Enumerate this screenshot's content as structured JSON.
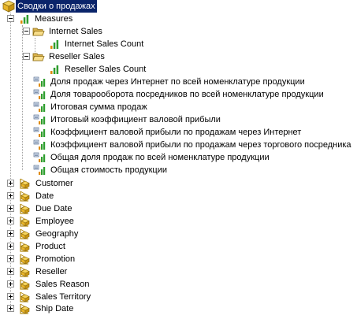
{
  "cube": {
    "label": "Сводки о продажах"
  },
  "measures": {
    "label": "Measures",
    "groups": [
      {
        "label": "Internet Sales",
        "items": [
          "Internet Sales Count"
        ]
      },
      {
        "label": "Reseller Sales",
        "items": [
          "Reseller Sales Count"
        ]
      }
    ],
    "calculated": [
      "Доля продаж через Интернет по всей номенклатуре продукции",
      "Доля товарооборота посредников по всей номенклатуре продукции",
      "Итоговая сумма продаж",
      "Итоговый коэффициент валовой прибыли",
      "Коэффициент валовой прибыли по продажам через Интернет",
      "Коэффициент валовой прибыли по продажам через торгового посредника",
      "Общая доля продаж по всей номенклатуре продукции",
      "Общая стоимость продукции"
    ]
  },
  "dimensions": [
    "Customer",
    "Date",
    "Due Date",
    "Employee",
    "Geography",
    "Product",
    "Promotion",
    "Reseller",
    "Sales Reason",
    "Sales Territory",
    "Ship Date"
  ],
  "colors": {
    "selection": "#0a246a",
    "folder": "#f2d17a",
    "cube": "#e8b428"
  }
}
